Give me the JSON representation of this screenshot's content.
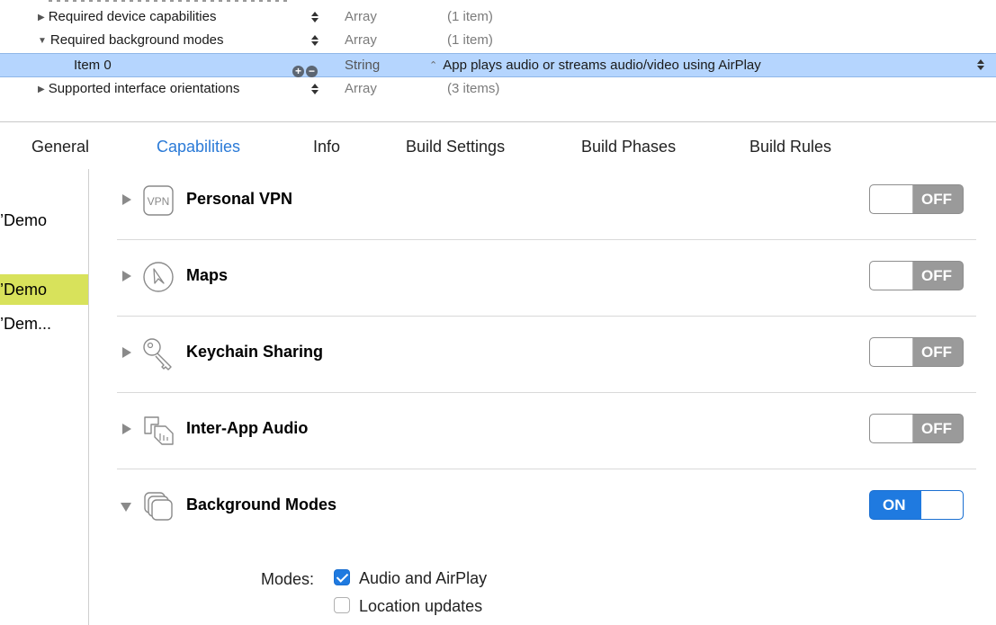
{
  "plist": {
    "rows": [
      {
        "key": "Required device capabilities",
        "type": "Array",
        "value": "(1 item)"
      },
      {
        "key": "Required background modes",
        "type": "Array",
        "value": "(1 item)"
      },
      {
        "key": "Item 0",
        "type": "String",
        "value": "App plays audio or streams audio/video using AirPlay"
      },
      {
        "key": "Supported interface orientations",
        "type": "Array",
        "value": "(3 items)"
      }
    ]
  },
  "tabs": [
    "General",
    "Capabilities",
    "Info",
    "Build Settings",
    "Build Phases",
    "Build Rules"
  ],
  "active_tab": "Capabilities",
  "sidebar": {
    "items": [
      "’Demo",
      "’Demo",
      "’Dem..."
    ]
  },
  "capabilities": [
    {
      "title": "Personal VPN",
      "state": "OFF",
      "icon": "vpn-icon"
    },
    {
      "title": "Maps",
      "state": "OFF",
      "icon": "compass-icon"
    },
    {
      "title": "Keychain Sharing",
      "state": "OFF",
      "icon": "key-icon"
    },
    {
      "title": "Inter-App Audio",
      "state": "OFF",
      "icon": "inter-app-audio-icon"
    },
    {
      "title": "Background Modes",
      "state": "ON",
      "icon": "background-modes-icon"
    }
  ],
  "modes": {
    "label": "Modes:",
    "options": [
      {
        "label": "Audio and AirPlay",
        "checked": true
      },
      {
        "label": "Location updates",
        "checked": false
      }
    ]
  },
  "colors": {
    "accent": "#1f7ae0",
    "selection": "#b5d5fe",
    "sidebar_highlight": "#d8e25b",
    "toggle_off": "#9a9a9a"
  }
}
